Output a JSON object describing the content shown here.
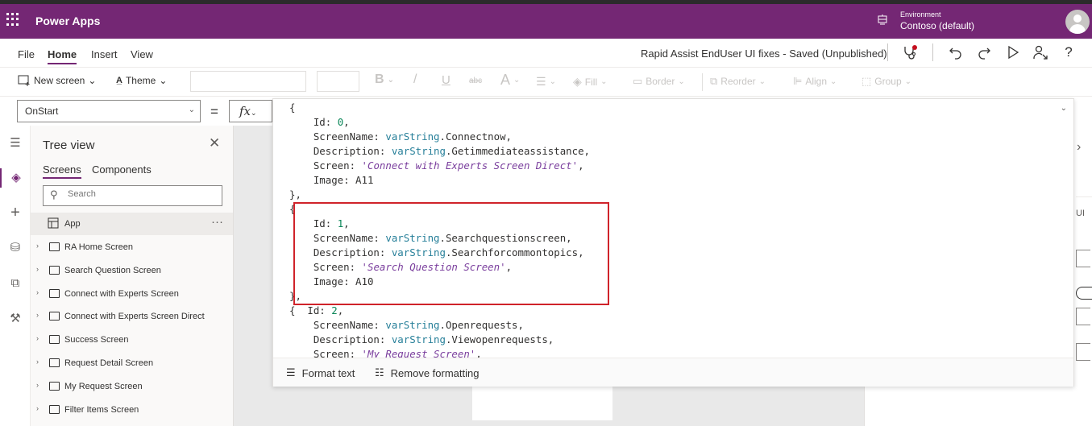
{
  "app": {
    "name": "Power Apps",
    "environment_label": "Environment",
    "environment_name": "Contoso (default)",
    "brand_color": "#742774"
  },
  "menu": {
    "items": [
      {
        "label": "File",
        "active": false
      },
      {
        "label": "Home",
        "active": true
      },
      {
        "label": "Insert",
        "active": false
      },
      {
        "label": "View",
        "active": false
      }
    ],
    "doc_title": "Rapid Assist EndUser UI fixes - Saved (Unpublished)",
    "icons": [
      "app-checker-icon",
      "undo-icon",
      "redo-icon",
      "preview-play-icon",
      "share-icon",
      "help-icon"
    ]
  },
  "ribbon": {
    "new_screen": "New screen",
    "theme": "Theme",
    "bold": "B",
    "italic": "/",
    "underline": "U",
    "strike": "abc",
    "font_size_icon": "A",
    "fill": "Fill",
    "border": "Border",
    "reorder": "Reorder",
    "align": "Align",
    "group": "Group"
  },
  "formula": {
    "property": "OnStart",
    "equals": "=",
    "fx": "fx"
  },
  "code": {
    "lines": [
      [
        [
          "k",
          "{"
        ]
      ],
      [
        [
          "k",
          "    Id: "
        ],
        [
          "n",
          "0"
        ],
        [
          "k",
          ","
        ]
      ],
      [
        [
          "k",
          "    ScreenName: "
        ],
        [
          "v",
          "varString"
        ],
        [
          "k",
          ".Connectnow,"
        ]
      ],
      [
        [
          "k",
          "    Description: "
        ],
        [
          "v",
          "varString"
        ],
        [
          "k",
          ".Getimmediateassistance,"
        ]
      ],
      [
        [
          "k",
          "    Screen: "
        ],
        [
          "s",
          "'Connect with Experts Screen Direct'"
        ],
        [
          "k",
          ","
        ]
      ],
      [
        [
          "k",
          "    Image: A11"
        ]
      ],
      [
        [
          "k",
          "},"
        ]
      ],
      [
        [
          "k",
          "{"
        ]
      ],
      [
        [
          "k",
          "    Id: "
        ],
        [
          "n",
          "1"
        ],
        [
          "k",
          ","
        ]
      ],
      [
        [
          "k",
          "    ScreenName: "
        ],
        [
          "v",
          "varString"
        ],
        [
          "k",
          ".Searchquestionscreen,"
        ]
      ],
      [
        [
          "k",
          "    Description: "
        ],
        [
          "v",
          "varString"
        ],
        [
          "k",
          ".Searchforcommontopics,"
        ]
      ],
      [
        [
          "k",
          "    Screen: "
        ],
        [
          "s",
          "'Search Question Screen'"
        ],
        [
          "k",
          ","
        ]
      ],
      [
        [
          "k",
          "    Image: A10"
        ]
      ],
      [
        [
          "k",
          "},"
        ]
      ],
      [
        [
          "k",
          "{  Id: "
        ],
        [
          "n",
          "2"
        ],
        [
          "k",
          ","
        ]
      ],
      [
        [
          "k",
          "    ScreenName: "
        ],
        [
          "v",
          "varString"
        ],
        [
          "k",
          ".Openrequests,"
        ]
      ],
      [
        [
          "k",
          "    Description: "
        ],
        [
          "v",
          "varString"
        ],
        [
          "k",
          ".Viewopenrequests,"
        ]
      ],
      [
        [
          "k",
          "    Screen: "
        ],
        [
          "s",
          "'My Request Screen'"
        ],
        [
          "k",
          ","
        ]
      ]
    ],
    "highlight_color": "#d0232a"
  },
  "editor_footer": {
    "format_text": "Format text",
    "remove_formatting": "Remove formatting"
  },
  "tree": {
    "title": "Tree view",
    "tabs": [
      {
        "label": "Screens",
        "active": true
      },
      {
        "label": "Components",
        "active": false
      }
    ],
    "search_placeholder": "Search",
    "app_label": "App",
    "screens": [
      "RA Home Screen",
      "Search Question Screen",
      "Connect with Experts Screen",
      "Connect with Experts Screen Direct",
      "Success Screen",
      "Request Detail Screen",
      "My Request Screen",
      "Filter Items Screen"
    ]
  },
  "right_panel": {
    "partial_text": "UI"
  }
}
